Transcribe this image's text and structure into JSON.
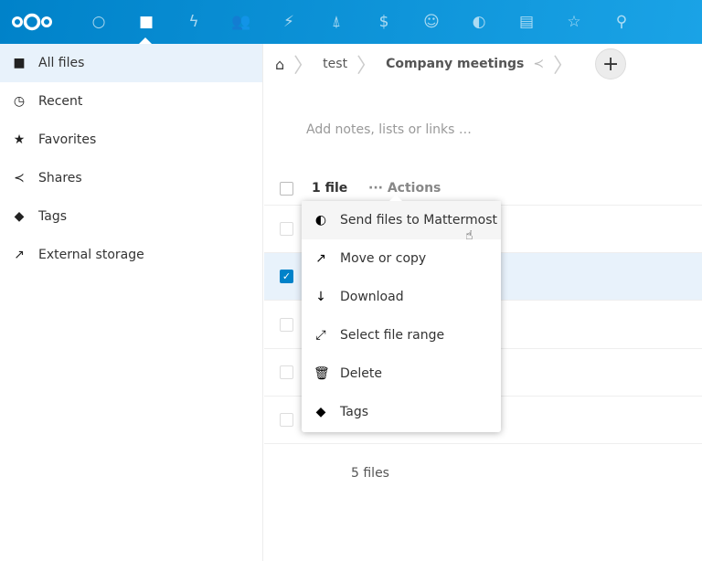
{
  "topbar": {
    "apps": [
      "dashboard",
      "files",
      "activity",
      "contacts",
      "deck",
      "phonetrack",
      "money",
      "talk",
      "mattermost",
      "stack",
      "cospend",
      "maps"
    ],
    "active": "files"
  },
  "sidebar": {
    "items": [
      {
        "label": "All files",
        "icon": "folder-icon",
        "active": true
      },
      {
        "label": "Recent",
        "icon": "clock-icon"
      },
      {
        "label": "Favorites",
        "icon": "star-icon"
      },
      {
        "label": "Shares",
        "icon": "share-icon"
      },
      {
        "label": "Tags",
        "icon": "tag-icon"
      },
      {
        "label": "External storage",
        "icon": "external-icon"
      }
    ]
  },
  "breadcrumb": {
    "items": [
      "test",
      "Company meetings"
    ]
  },
  "notes_placeholder": "Add notes, lists or links …",
  "list": {
    "selected_count": "1 file",
    "actions_label": "Actions",
    "summary": "5 files"
  },
  "menu": {
    "items": [
      {
        "label": "Send files to Mattermost",
        "icon": "mattermost-icon"
      },
      {
        "label": "Move or copy",
        "icon": "external-link-icon"
      },
      {
        "label": "Download",
        "icon": "download-icon"
      },
      {
        "label": "Select file range",
        "icon": "range-icon"
      },
      {
        "label": "Delete",
        "icon": "trash-icon"
      },
      {
        "label": "Tags",
        "icon": "tag-icon"
      }
    ]
  }
}
